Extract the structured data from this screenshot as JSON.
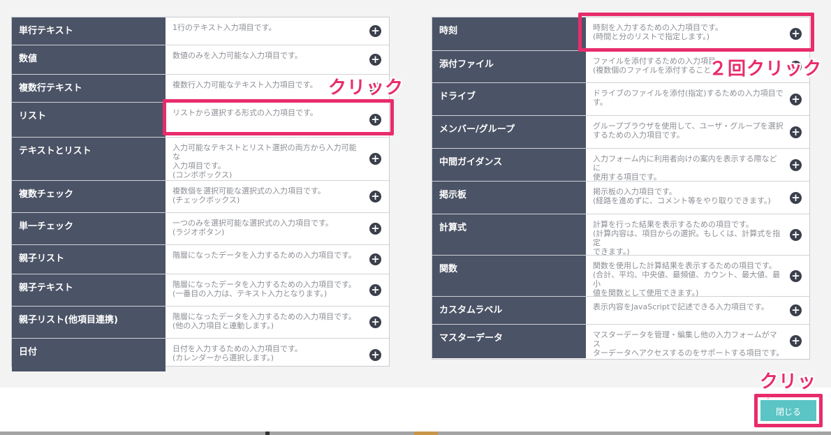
{
  "left_items": [
    {
      "label": "単行テキスト",
      "desc": "1行のテキスト入力項目です。"
    },
    {
      "label": "数値",
      "desc": "数値のみを入力可能な入力項目です。"
    },
    {
      "label": "複数行テキスト",
      "desc": "複数行入力可能なテキスト入力項目です。"
    },
    {
      "label": "リスト",
      "desc": "リストから選択する形式の入力項目です。"
    },
    {
      "label": "テキストとリスト",
      "desc": "入力可能なテキストとリスト選択の両方から入力可能な\n入力項目です。\n(コンボボックス)"
    },
    {
      "label": "複数チェック",
      "desc": "複数個を選択可能な選択式の入力項目です。\n(チェックボックス)"
    },
    {
      "label": "単一チェック",
      "desc": "一つのみを選択可能な選択式の入力項目です。\n(ラジオボタン)"
    },
    {
      "label": "親子リスト",
      "desc": "階層になったデータを入力するための入力項目です。"
    },
    {
      "label": "親子テキスト",
      "desc": "階層になったデータを入力するための入力項目です。\n(一番目の入力は、テキスト入力となります。)"
    },
    {
      "label": "親子リスト(他項目連携)",
      "desc": "階層になったデータを入力するための入力項目です。\n(他の入力項目と連動します。)"
    },
    {
      "label": "日付",
      "desc": "日付を入力するための入力項目です。\n(カレンダーから選択します。)"
    }
  ],
  "right_items": [
    {
      "label": "時刻",
      "desc": "時刻を入力するための入力項目です。\n(時間と分のリストで指定します。)"
    },
    {
      "label": "添付ファイル",
      "desc": "ファイルを添付するための入力項目\n(複数個のファイルを添付すること"
    },
    {
      "label": "ドライブ",
      "desc": "ドライブのファイルを添付(指定)するための入力項目で\nす。"
    },
    {
      "label": "メンバー/グループ",
      "desc": "グループブラウザを使用して、ユーザ・グループを選択\nするための入力項目です。"
    },
    {
      "label": "中間ガイダンス",
      "desc": "入力フォーム内に利用者向けの案内を表示する際などに\n使用する項目です。"
    },
    {
      "label": "掲示板",
      "desc": "掲示板の入力項目です。\n(経路を進めずに、コメント等をやり取りできます。)"
    },
    {
      "label": "計算式",
      "desc": "計算を行った結果を表示するための項目です。\n(計算内容は、項目からの選択。もしくは、計算式を指定\nできます。)"
    },
    {
      "label": "関数",
      "desc": "関数を使用した計算結果を表示するための項目です。\n(合計、平均、中央値、最頻値、カウント、最大値、最小\n値を関数として使用できます。)"
    },
    {
      "label": "カスタムラベル",
      "desc": "表示内容をJavaScriptで記述できる入力項目です。"
    },
    {
      "label": "マスターデータ",
      "desc": "マスターデータを管理・編集し他の入力フォームがマス\nターデータへアクセスするのをサポートする項目です。"
    }
  ],
  "add_symbol": "+",
  "annotations": {
    "click_list": "クリック",
    "double_click_time": "２回クリック",
    "click_close": "クリック"
  },
  "footer": {
    "close_label": "閉じる"
  },
  "colors": {
    "label_bg": "#4b5366",
    "highlight": "#e82c6b",
    "close_button": "#5bc4c4"
  }
}
